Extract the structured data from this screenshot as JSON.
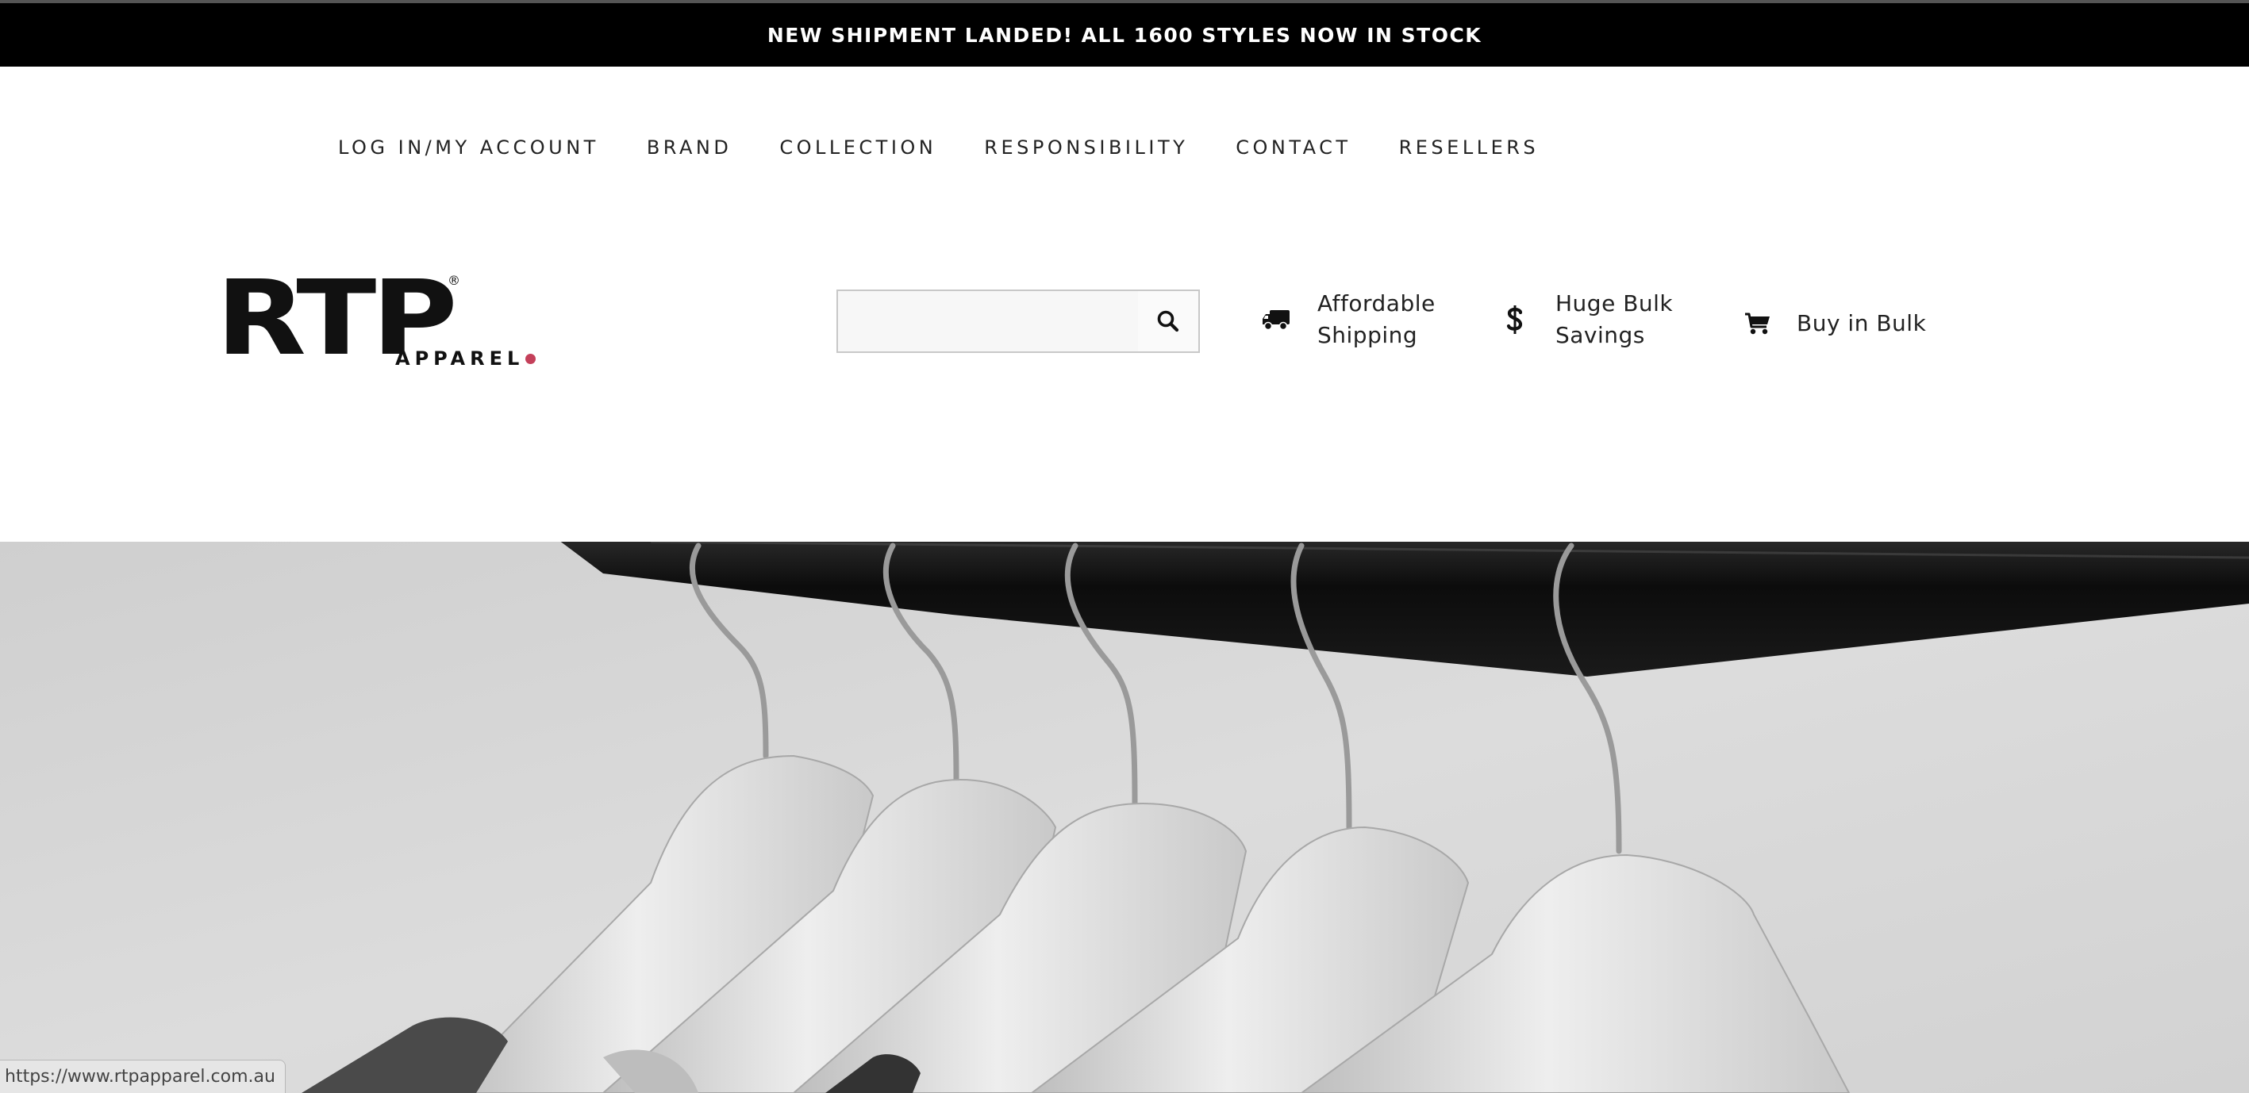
{
  "announcement": {
    "text": "NEW SHIPMENT LANDED! ALL 1600 STYLES NOW IN STOCK"
  },
  "nav": {
    "items": [
      {
        "label": "LOG IN/MY ACCOUNT"
      },
      {
        "label": "BRAND"
      },
      {
        "label": "COLLECTION"
      },
      {
        "label": "RESPONSIBILITY"
      },
      {
        "label": "CONTACT"
      },
      {
        "label": "RESELLERS"
      }
    ]
  },
  "logo": {
    "main": "RTP",
    "sub": "APPAREL",
    "registered": "®",
    "dot_color": "#c4405a"
  },
  "search": {
    "value": "",
    "placeholder": "",
    "icon": "search-icon"
  },
  "features": {
    "shipping": {
      "icon": "truck-icon",
      "line1": "Affordable",
      "line2": "Shipping"
    },
    "savings": {
      "icon": "dollar-icon",
      "line1": "Huge Bulk",
      "line2": "Savings"
    },
    "buy": {
      "icon": "cart-icon",
      "label": "Buy in Bulk"
    }
  },
  "hero": {
    "image": "clothes-hangers-on-rail-photo"
  },
  "status_url": "https://www.rtpapparel.com.au",
  "colors": {
    "bar_bg": "#000000",
    "accent_dot": "#c4405a",
    "text": "#222222"
  }
}
